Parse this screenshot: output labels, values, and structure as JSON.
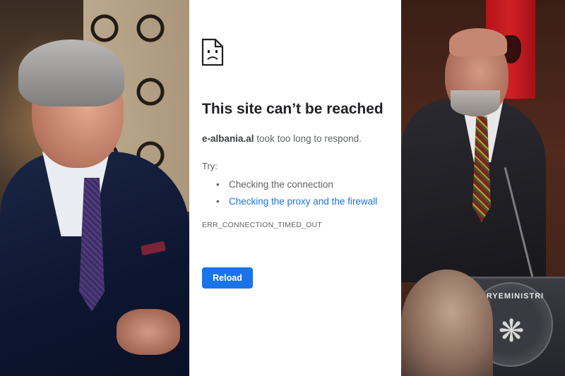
{
  "left_photo": {
    "subject": "Older man with gray hair in dark suit, seated, smiling"
  },
  "error_page": {
    "icon": "sad-document-icon",
    "title": "This site can’t be reached",
    "host": "e-albania.al",
    "desc_rest": " took too long to respond.",
    "try_label": "Try:",
    "suggestions": [
      {
        "label": "Checking the connection",
        "link": false
      },
      {
        "label": "Checking the proxy and the firewall",
        "link": true
      }
    ],
    "error_code": "ERR_CONNECTION_TIMED_OUT",
    "reload_label": "Reload",
    "colors": {
      "accent": "#1a73e8",
      "text": "#202124",
      "muted": "#5f6368"
    }
  },
  "right_photo": {
    "subject": "Man with gray beard at podium with red flag",
    "seal_text": "KRYEMINISTRI"
  }
}
